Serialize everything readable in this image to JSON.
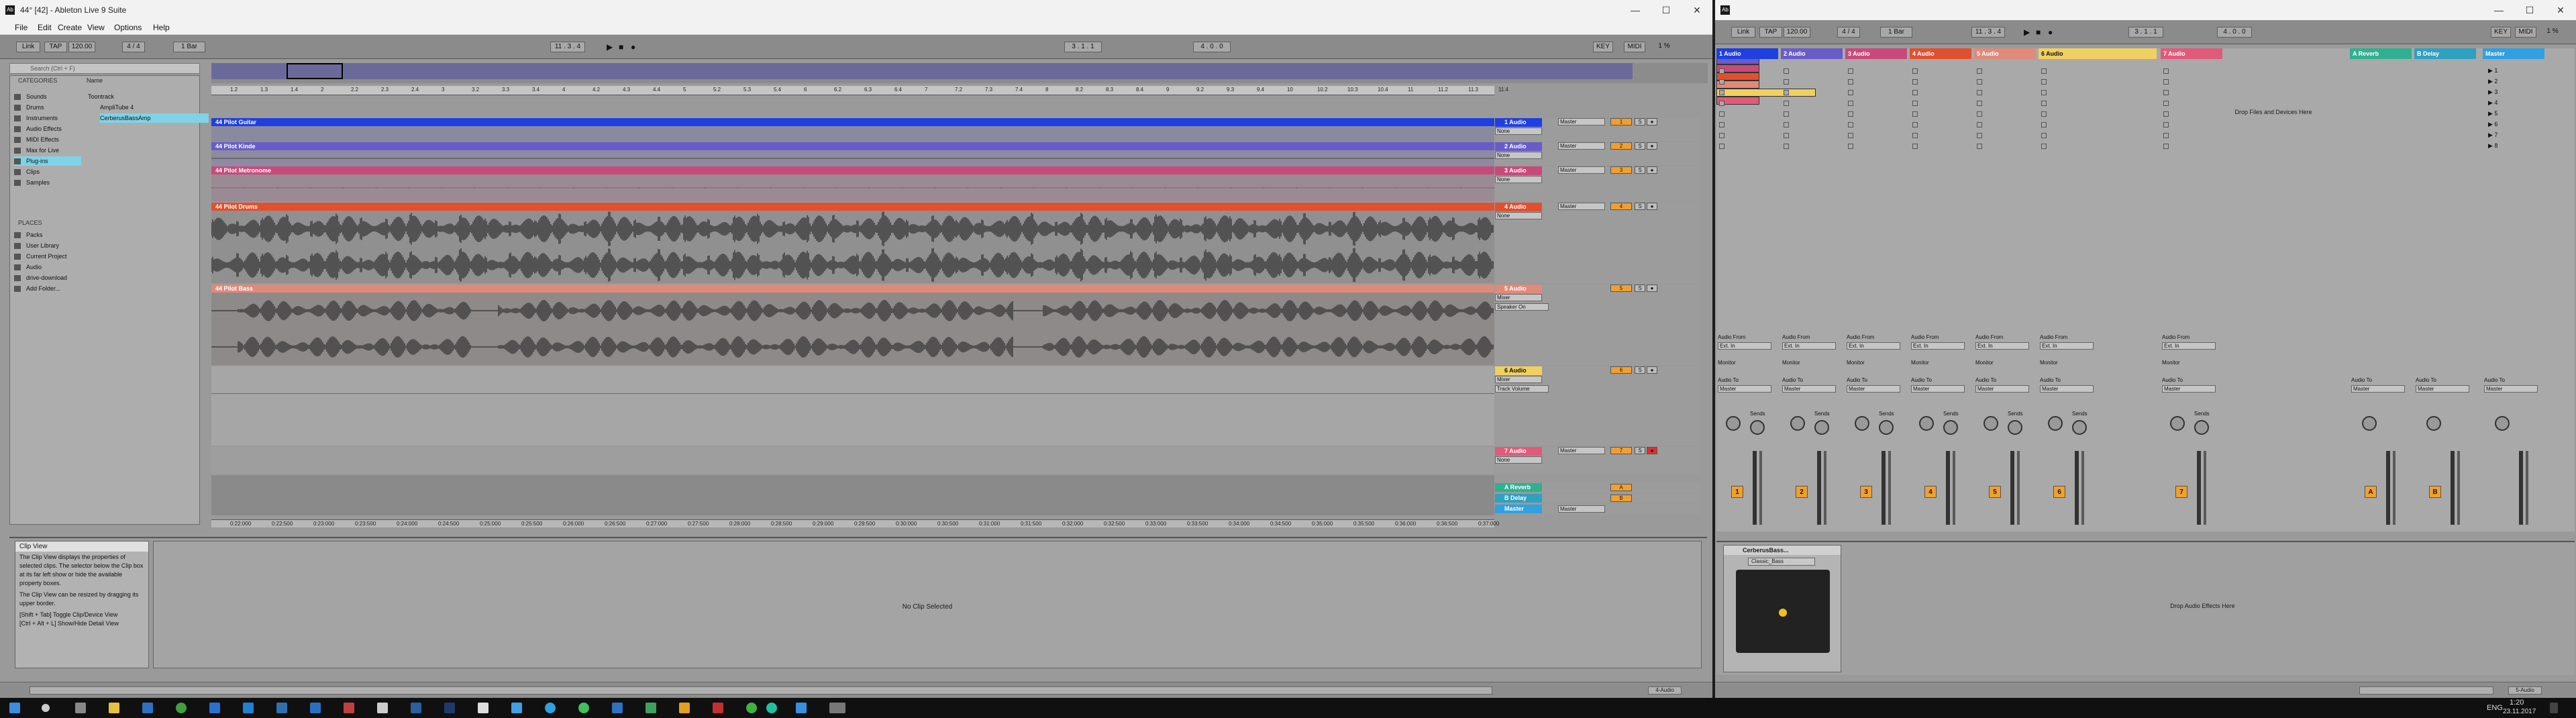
{
  "left": {
    "title": "44° [42] - Ableton Live 9 Suite",
    "menu": [
      "File",
      "Edit",
      "Create",
      "View",
      "Options",
      "Help"
    ],
    "control": {
      "link": "Link",
      "tap": "TAP",
      "tempo": "120.00",
      "sig": "4 / 4",
      "quant": "1 Bar",
      "pos": "11 . 3 . 4",
      "pos2": "3 . 1 . 1",
      "loop_len": "4 . 0 . 0",
      "key": "KEY",
      "midi": "MIDI",
      "cpu": "1 %"
    },
    "browser": {
      "search": "Search (Ctrl + F)",
      "categories_label": "CATEGORIES",
      "categories": [
        "Sounds",
        "Drums",
        "Instruments",
        "Audio Effects",
        "MIDI Effects",
        "Max for Live",
        "Plug-ins",
        "Clips",
        "Samples"
      ],
      "places_label": "PLACES",
      "places": [
        "Packs",
        "User Library",
        "Current Project",
        "Audio",
        "drive-download",
        "Add Folder..."
      ],
      "name_header": "Name",
      "items": [
        "Toontrack",
        "AmpliTube 4",
        "CerberusBassAmp"
      ]
    },
    "ruler": [
      "1.2",
      "1.3",
      "1.4",
      "2",
      "2.2",
      "2.3",
      "2.4",
      "3",
      "3.2",
      "3.3",
      "3.4",
      "4",
      "4.2",
      "4.3",
      "4.4",
      "5",
      "5.2",
      "5.3",
      "5.4",
      "6",
      "6.2",
      "6.3",
      "6.4",
      "7",
      "7.2",
      "7.3",
      "7.4",
      "8",
      "8.2",
      "8.3",
      "8.4",
      "9",
      "9.2",
      "9.3",
      "9.4",
      "10",
      "10.2",
      "10.3",
      "10.4",
      "11",
      "11.2",
      "11.3",
      "11.4"
    ],
    "tracks": [
      {
        "clip": "44 Pilot Guitar",
        "name": "1 Audio",
        "color": "#1f3fe0",
        "io_in": "None",
        "io_out": "Master"
      },
      {
        "clip": "44 Pilot Kinde",
        "name": "2 Audio",
        "color": "#6a5cc8",
        "io_in": "None",
        "io_out": "Master"
      },
      {
        "clip": "44 Pilot Metronome",
        "name": "3 Audio",
        "color": "#c84a7a",
        "io_in": "None",
        "io_out": "Master"
      },
      {
        "clip": "44 Pilot Drums",
        "name": "4 Audio",
        "color": "#e05030",
        "io_in": "None",
        "io_out": "Master"
      },
      {
        "clip": "44 Pilot Bass",
        "name": "5 Audio",
        "color": "#e08a7a",
        "io_in": "Mixer",
        "io_out": "Speaker On"
      },
      {
        "clip": "",
        "name": "6 Audio",
        "color": "#f0d060",
        "io_in": "Mixer",
        "io_out": "Track Volume"
      },
      {
        "clip": "",
        "name": "7 Audio",
        "color": "#e05a7a",
        "io_in": "None",
        "io_out": "Master"
      }
    ],
    "returns": [
      {
        "name": "A Reverb",
        "color": "#30b090"
      },
      {
        "name": "B Delay",
        "color": "#30a0c0"
      },
      {
        "name": "Master",
        "color": "#30a0e0"
      }
    ],
    "timeline": [
      "0:22:000",
      "0:22:500",
      "0:23:000",
      "0:23:500",
      "0:24:000",
      "0:24:500",
      "0:25:000",
      "0:25:500",
      "0:26:000",
      "0:26:500",
      "0:27:000",
      "0:27:500",
      "0:28:000",
      "0:28:500",
      "0:29:000",
      "0:29:500",
      "0:30:000",
      "0:30:500",
      "0:31:000",
      "0:31:500",
      "0:32:000",
      "0:32:500",
      "0:33:000",
      "0:33:500",
      "0:34:000",
      "0:34:500",
      "0:35:000",
      "0:35:500",
      "0:36:000",
      "0:36:500",
      "0:37:000"
    ],
    "info": {
      "title": "Clip View",
      "p1": "The Clip View displays the properties of selected clips. The selector below the Clip box at its far left show or hide the available property boxes.",
      "p2": "The Clip View can be resized by dragging its upper border.",
      "p3": "[Shift + Tab] Toggle Clip/Device View\n[Ctrl + Alt + L] Show/Hide Detail View"
    },
    "no_clip": "No Clip Selected",
    "status": "4-Audio"
  },
  "right": {
    "headers": [
      {
        "name": "1 Audio",
        "color": "#1f3fe0"
      },
      {
        "name": "2 Audio",
        "color": "#6a5cc8"
      },
      {
        "name": "3 Audio",
        "color": "#c84a7a"
      },
      {
        "name": "4 Audio",
        "color": "#e05030"
      },
      {
        "name": "5 Audio",
        "color": "#e08a7a"
      },
      {
        "name": "6 Audio",
        "color": "#f0d060"
      },
      {
        "name": "7 Audio",
        "color": "#e05a7a"
      }
    ],
    "returns": [
      {
        "name": "A Reverb",
        "color": "#30b090"
      },
      {
        "name": "B Delay",
        "color": "#30a0c0"
      },
      {
        "name": "Master",
        "color": "#30a0e0"
      }
    ],
    "drop_files": "Drop Files and Devices Here",
    "scenes": [
      "1",
      "2",
      "3",
      "4",
      "5",
      "6",
      "7",
      "8"
    ],
    "nums": [
      "1",
      "2",
      "3",
      "4",
      "5",
      "6",
      "7"
    ],
    "return_nums": [
      "A",
      "B"
    ],
    "audio_from": "Audio From",
    "audio_to": "Audio To",
    "monitor": "Monitor",
    "ext_in": "Ext. In",
    "master": "Master",
    "sends": "Sends",
    "device": {
      "name": "CerberusBass...",
      "preset": "Classic_Bass",
      "drop": "Drop Audio Effects Here"
    },
    "status": "5-Audio",
    "clock": "1:20",
    "date": "23.11.2017",
    "lang": "ENG"
  }
}
